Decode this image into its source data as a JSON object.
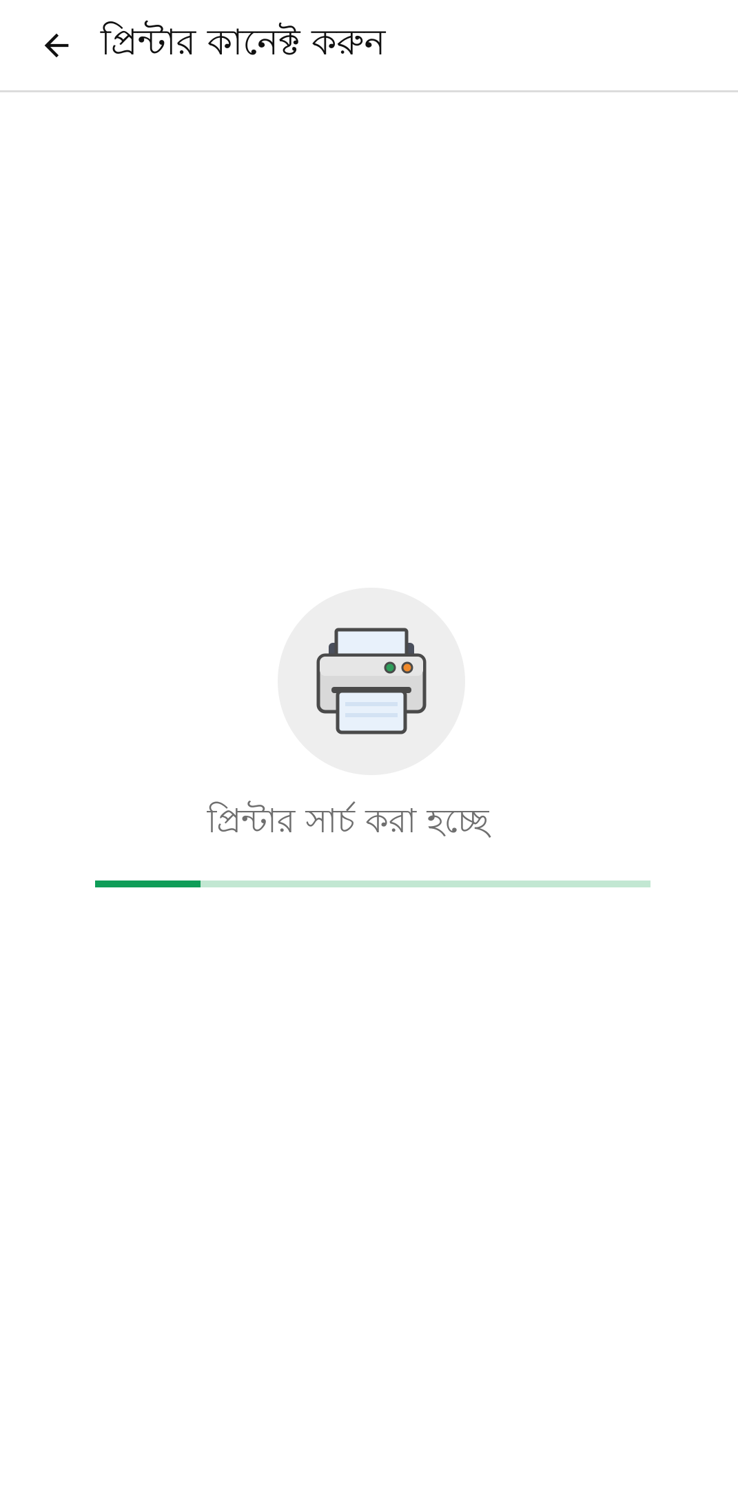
{
  "header": {
    "title": "প্রিন্টার কানেক্ট করুন",
    "back_icon": "arrow-back-icon"
  },
  "main": {
    "printer_icon": "printer-icon",
    "status_text": "প্রিন্টার সার্চ করা হচ্ছে",
    "progress": 0.19
  },
  "colors": {
    "background": "#ffffff",
    "circle_bg": "#eeeeee",
    "progress_fill": "#0f9d58",
    "progress_track": "#c2e7d2",
    "status_text": "#6f6f6f",
    "title_text": "#111111"
  }
}
